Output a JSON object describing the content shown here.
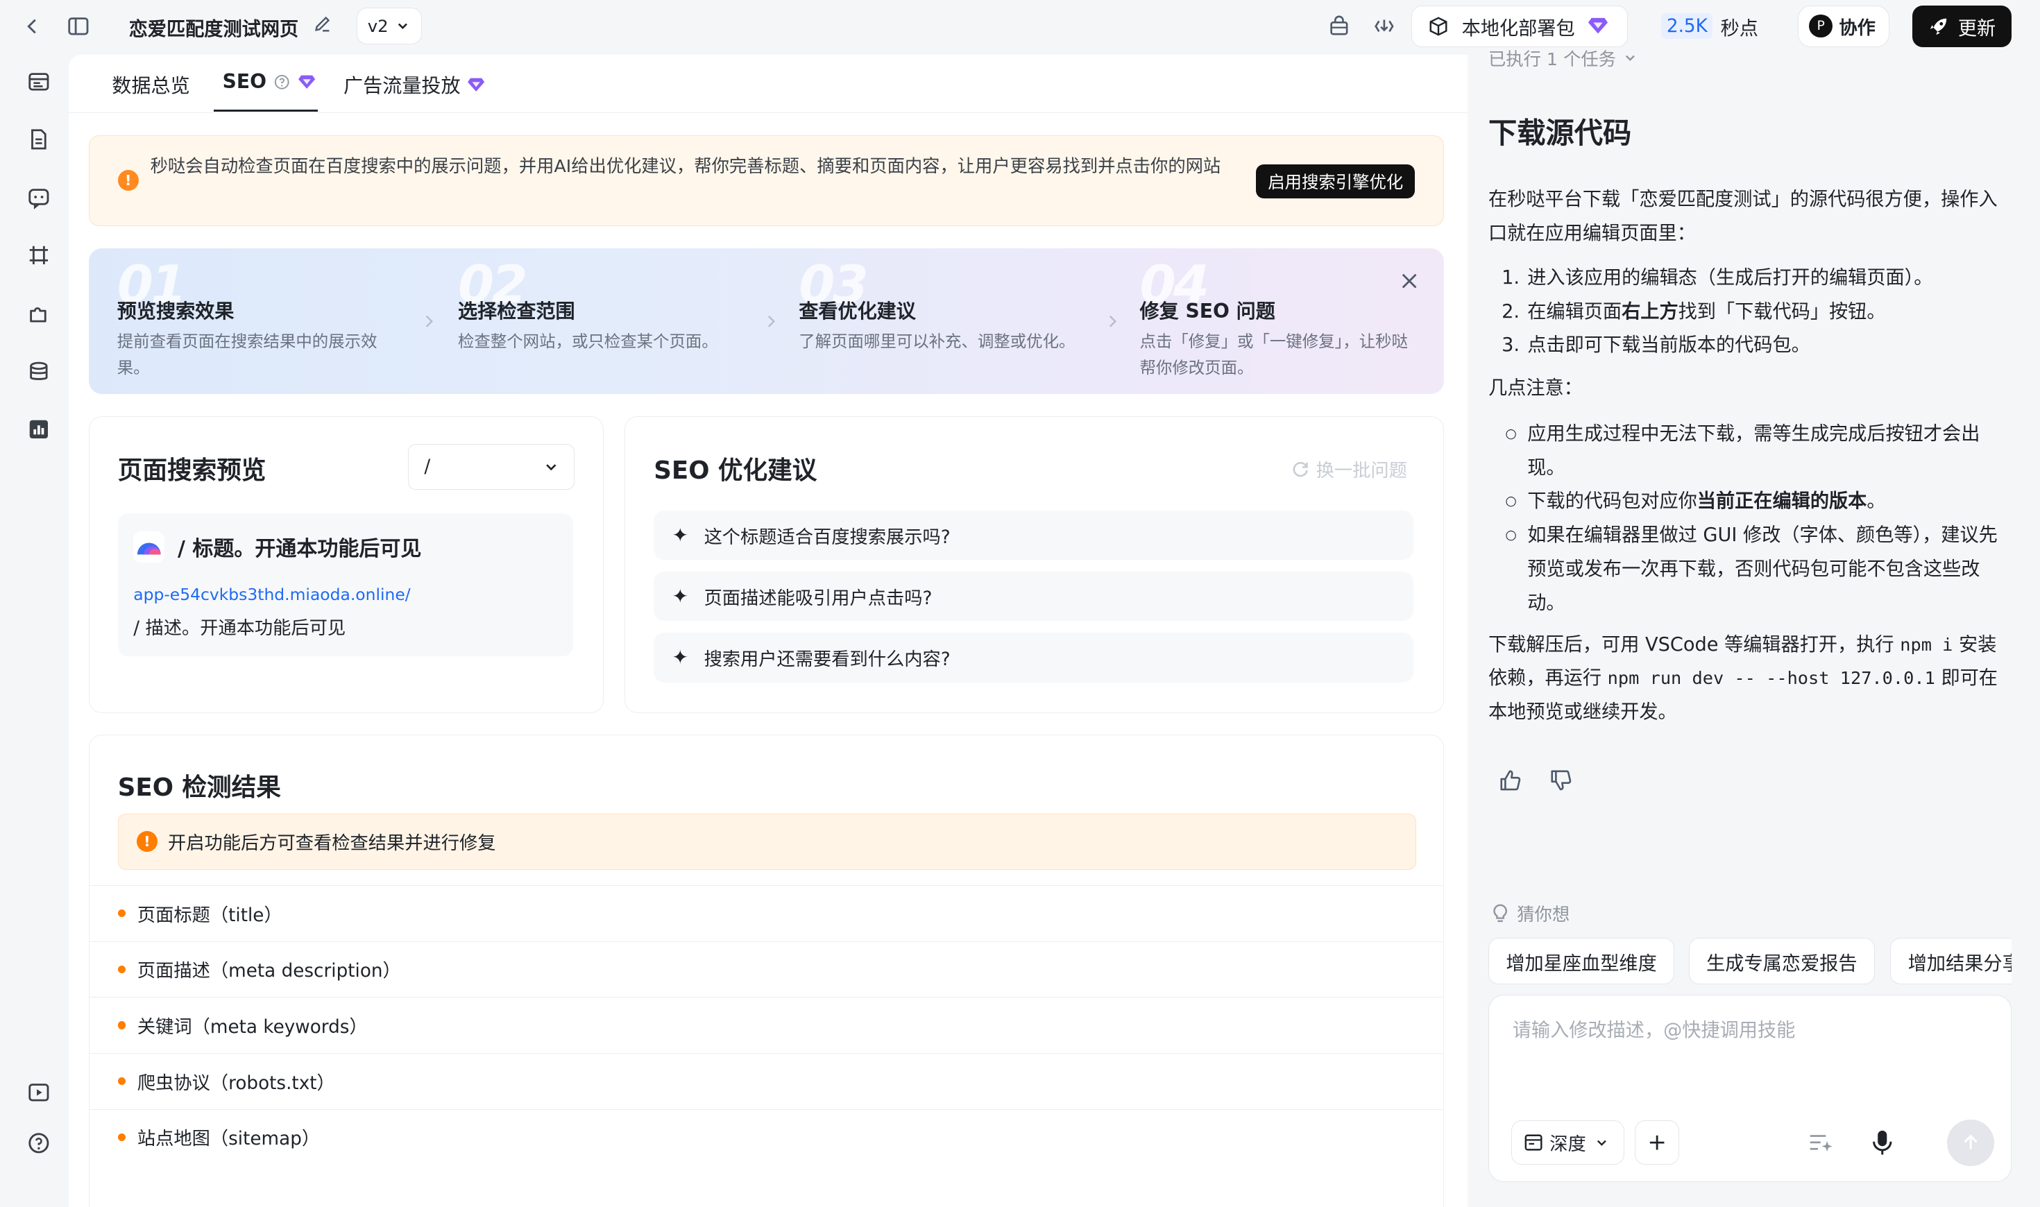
{
  "header": {
    "app_title": "恋爱匹配度测试网页",
    "version": "v2",
    "deploy_label": "本地化部署包",
    "credits_value": "2.5K",
    "credits_unit": "秒点",
    "avatar_letter": "P",
    "collab_label": "协作",
    "update_label": "更新"
  },
  "tabs": [
    {
      "label": "数据总览"
    },
    {
      "label": "SEO"
    },
    {
      "label": "广告流量投放"
    }
  ],
  "banner": {
    "text": "秒哒会自动检查页面在百度搜索中的展示问题，并用AI给出优化建议，帮你完善标题、摘要和页面内容，让用户更容易找到并点击你的网站",
    "button": "启用搜索引擎优化"
  },
  "steps": [
    {
      "num": "01",
      "title": "预览搜索效果",
      "desc": "提前查看页面在搜索结果中的展示效果。"
    },
    {
      "num": "02",
      "title": "选择检查范围",
      "desc": "检查整个网站，或只检查某个页面。"
    },
    {
      "num": "03",
      "title": "查看优化建议",
      "desc": "了解页面哪里可以补充、调整或优化。"
    },
    {
      "num": "04",
      "title": "修复 SEO 问题",
      "desc": "点击「修复」或「一键修复」，让秒哒帮你修改页面。"
    }
  ],
  "preview": {
    "title": "页面搜索预览",
    "select_value": "/",
    "result_title": "/ 标题。开通本功能后可见",
    "result_url": "app-e54cvkbs3thd.miaoda.online/",
    "result_desc": "/ 描述。开通本功能后可见"
  },
  "suggestions": {
    "title": "SEO 优化建议",
    "refresh_label": "换一批问题",
    "items": [
      {
        "text": "这个标题适合百度搜索展示吗?"
      },
      {
        "text": "页面描述能吸引用户点击吗?"
      },
      {
        "text": "搜索用户还需要看到什么内容?"
      }
    ]
  },
  "results": {
    "title": "SEO 检测结果",
    "notice": "开启功能后方可查看检查结果并进行修复",
    "items": [
      {
        "label": "页面标题（title）"
      },
      {
        "label": "页面描述（meta description）"
      },
      {
        "label": "关键词（meta keywords）"
      },
      {
        "label": "爬虫协议（robots.txt）"
      },
      {
        "label": "站点地图（sitemap）"
      }
    ]
  },
  "chat": {
    "executed_label": "已执行 1 个任务",
    "heading": "下载源代码",
    "intro": "在秒哒平台下载「恋爱匹配度测试」的源代码很方便，操作入口就在应用编辑页面里：",
    "steps": [
      {
        "text": "进入该应用的编辑态（生成后打开的编辑页面）。"
      },
      {
        "pre": "在编辑页面",
        "bold": "右上方",
        "post": "找到「下载代码」按钮。"
      },
      {
        "text": "点击即可下载当前版本的代码包。"
      }
    ],
    "notes_title": "几点注意：",
    "notes": [
      {
        "text": "应用生成过程中无法下载，需等生成完成后按钮才会出现。"
      },
      {
        "pre": "下载的代码包对应你",
        "bold": "当前正在编辑的版本",
        "post": "。"
      },
      {
        "text": "如果在编辑器里做过 GUI 修改（字体、颜色等），建议先预览或发布一次再下载，否则代码包可能不包含这些改动。"
      }
    ],
    "outro_1": "下载解压后，可用 VSCode 等编辑器打开，执行",
    "code_1": "npm i",
    "outro_2": "安装依赖，再运行",
    "code_2": "npm run dev -- --host 127.0.0.1",
    "outro_3": "即可在本地预览或继续开发。",
    "guess_label": "猜你想",
    "chips": [
      {
        "label": "增加星座血型维度"
      },
      {
        "label": "生成专属恋爱报告"
      },
      {
        "label": "增加结果分享"
      }
    ],
    "input_placeholder": "请输入修改描述，@快捷调用技能",
    "mode_label": "深度"
  },
  "colors": {
    "accent_blue": "#1d6bf3",
    "warning_orange": "#ff7d00",
    "banner_bg": "#fff7ec",
    "premium_purple": "#8a5cf6",
    "dark_button": "#111111"
  }
}
